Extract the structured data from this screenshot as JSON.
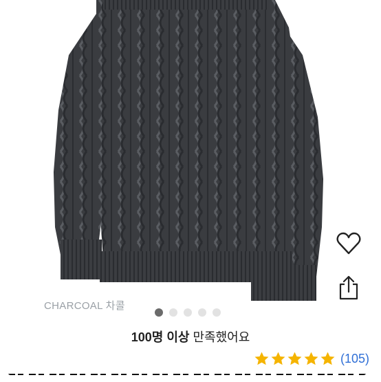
{
  "product": {
    "image_alt": "charcoal cable knit sweater",
    "color_label": "CHARCOAL 차콜",
    "colors": {
      "sweater": "#3a3c40",
      "background": "#ffffff"
    }
  },
  "carousel": {
    "total": 5,
    "current": 1
  },
  "satisfaction": {
    "bold": "100명 이상",
    "rest": " 만족했어요"
  },
  "rating": {
    "stars": 5,
    "star_color": "#f5b400",
    "review_count": "(105)"
  },
  "actions": {
    "like_icon": "heart-icon",
    "share_icon": "share-icon"
  }
}
